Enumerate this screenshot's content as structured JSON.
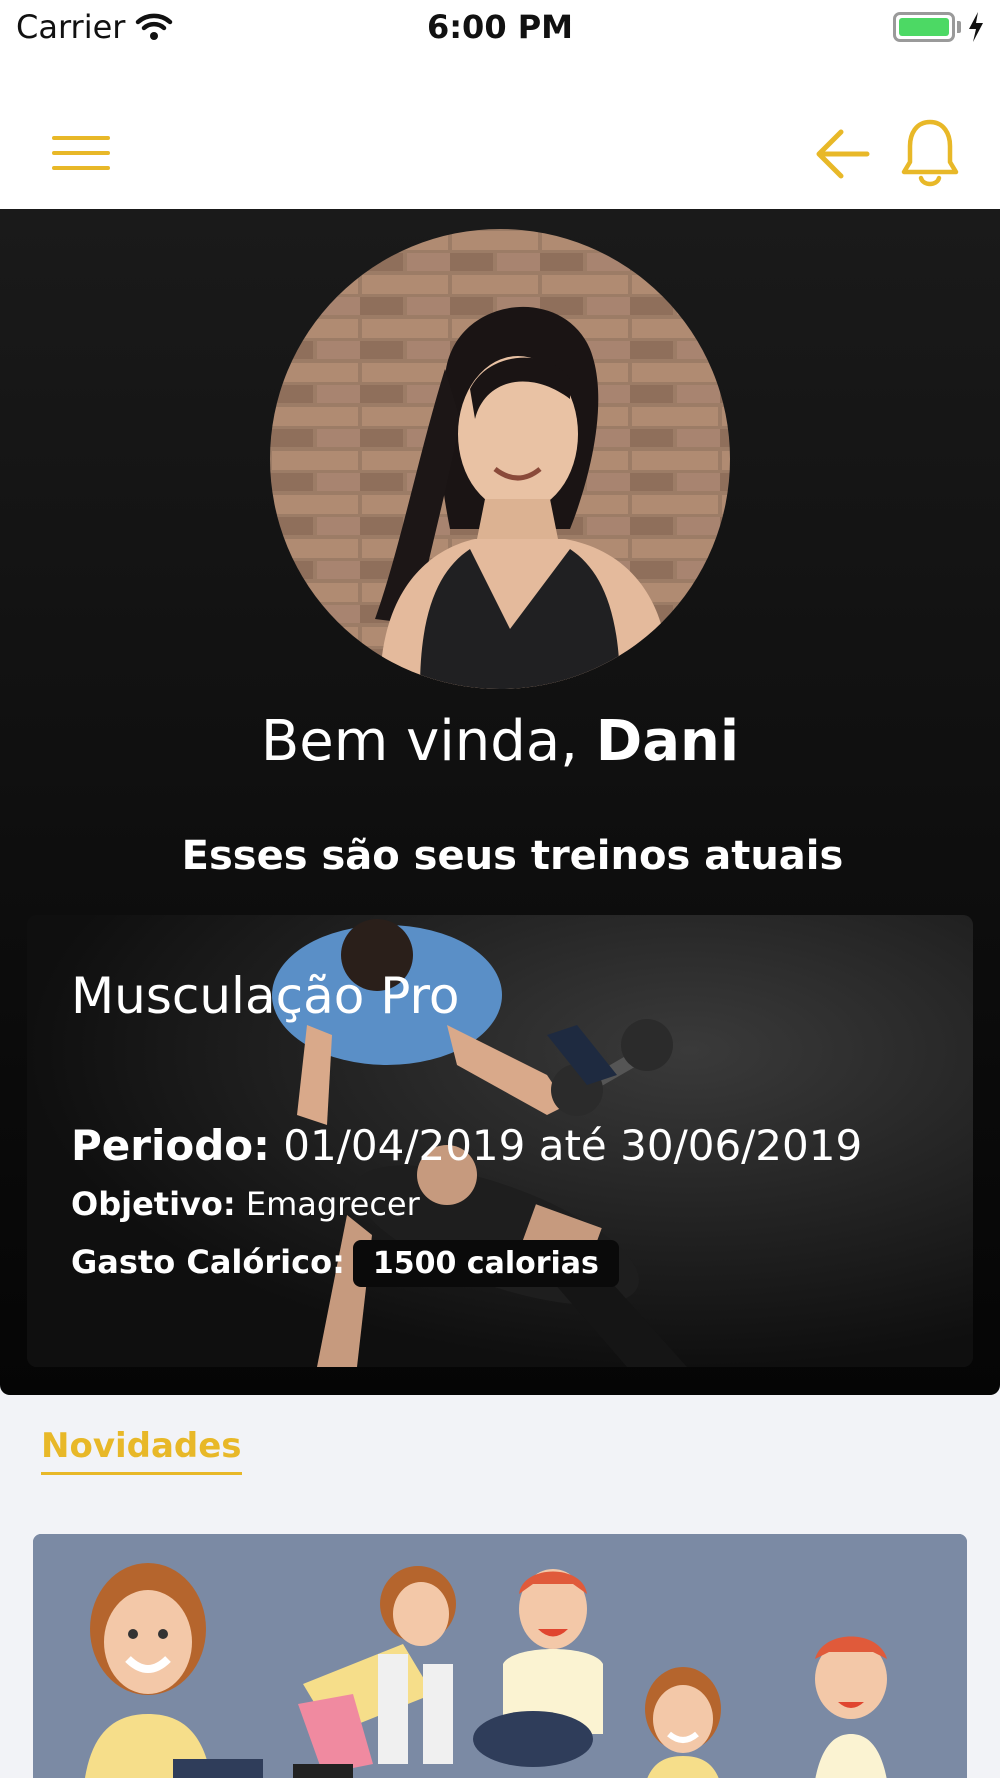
{
  "status_bar": {
    "carrier": "Carrier",
    "time": "6:00 PM",
    "battery_level": 1.0
  },
  "nav": {
    "menu_icon": "hamburger-menu-icon",
    "back_icon": "arrow-left-icon",
    "bell_icon": "bell-icon"
  },
  "colors": {
    "accent": "#e8b828",
    "hero_bg": "#0d0d0d",
    "page_bg": "#f2f3f7",
    "news_card_bg": "#7b8aa4",
    "battery": "#4cd964"
  },
  "profile": {
    "greeting": "Bem vinda, ",
    "name": "Dani"
  },
  "section_title": "Esses são seus treinos atuais",
  "workout": {
    "title": "Musculação Pro",
    "periodo_label": "Periodo:",
    "periodo_value": " 01/04/2019 até 30/06/2019",
    "objetivo_label": "Objetivo:",
    "objetivo_value": " Emagrecer",
    "gasto_label": "Gasto Calórico:",
    "gasto_value": "1500 calorias"
  },
  "news": {
    "title": "Novidades"
  }
}
